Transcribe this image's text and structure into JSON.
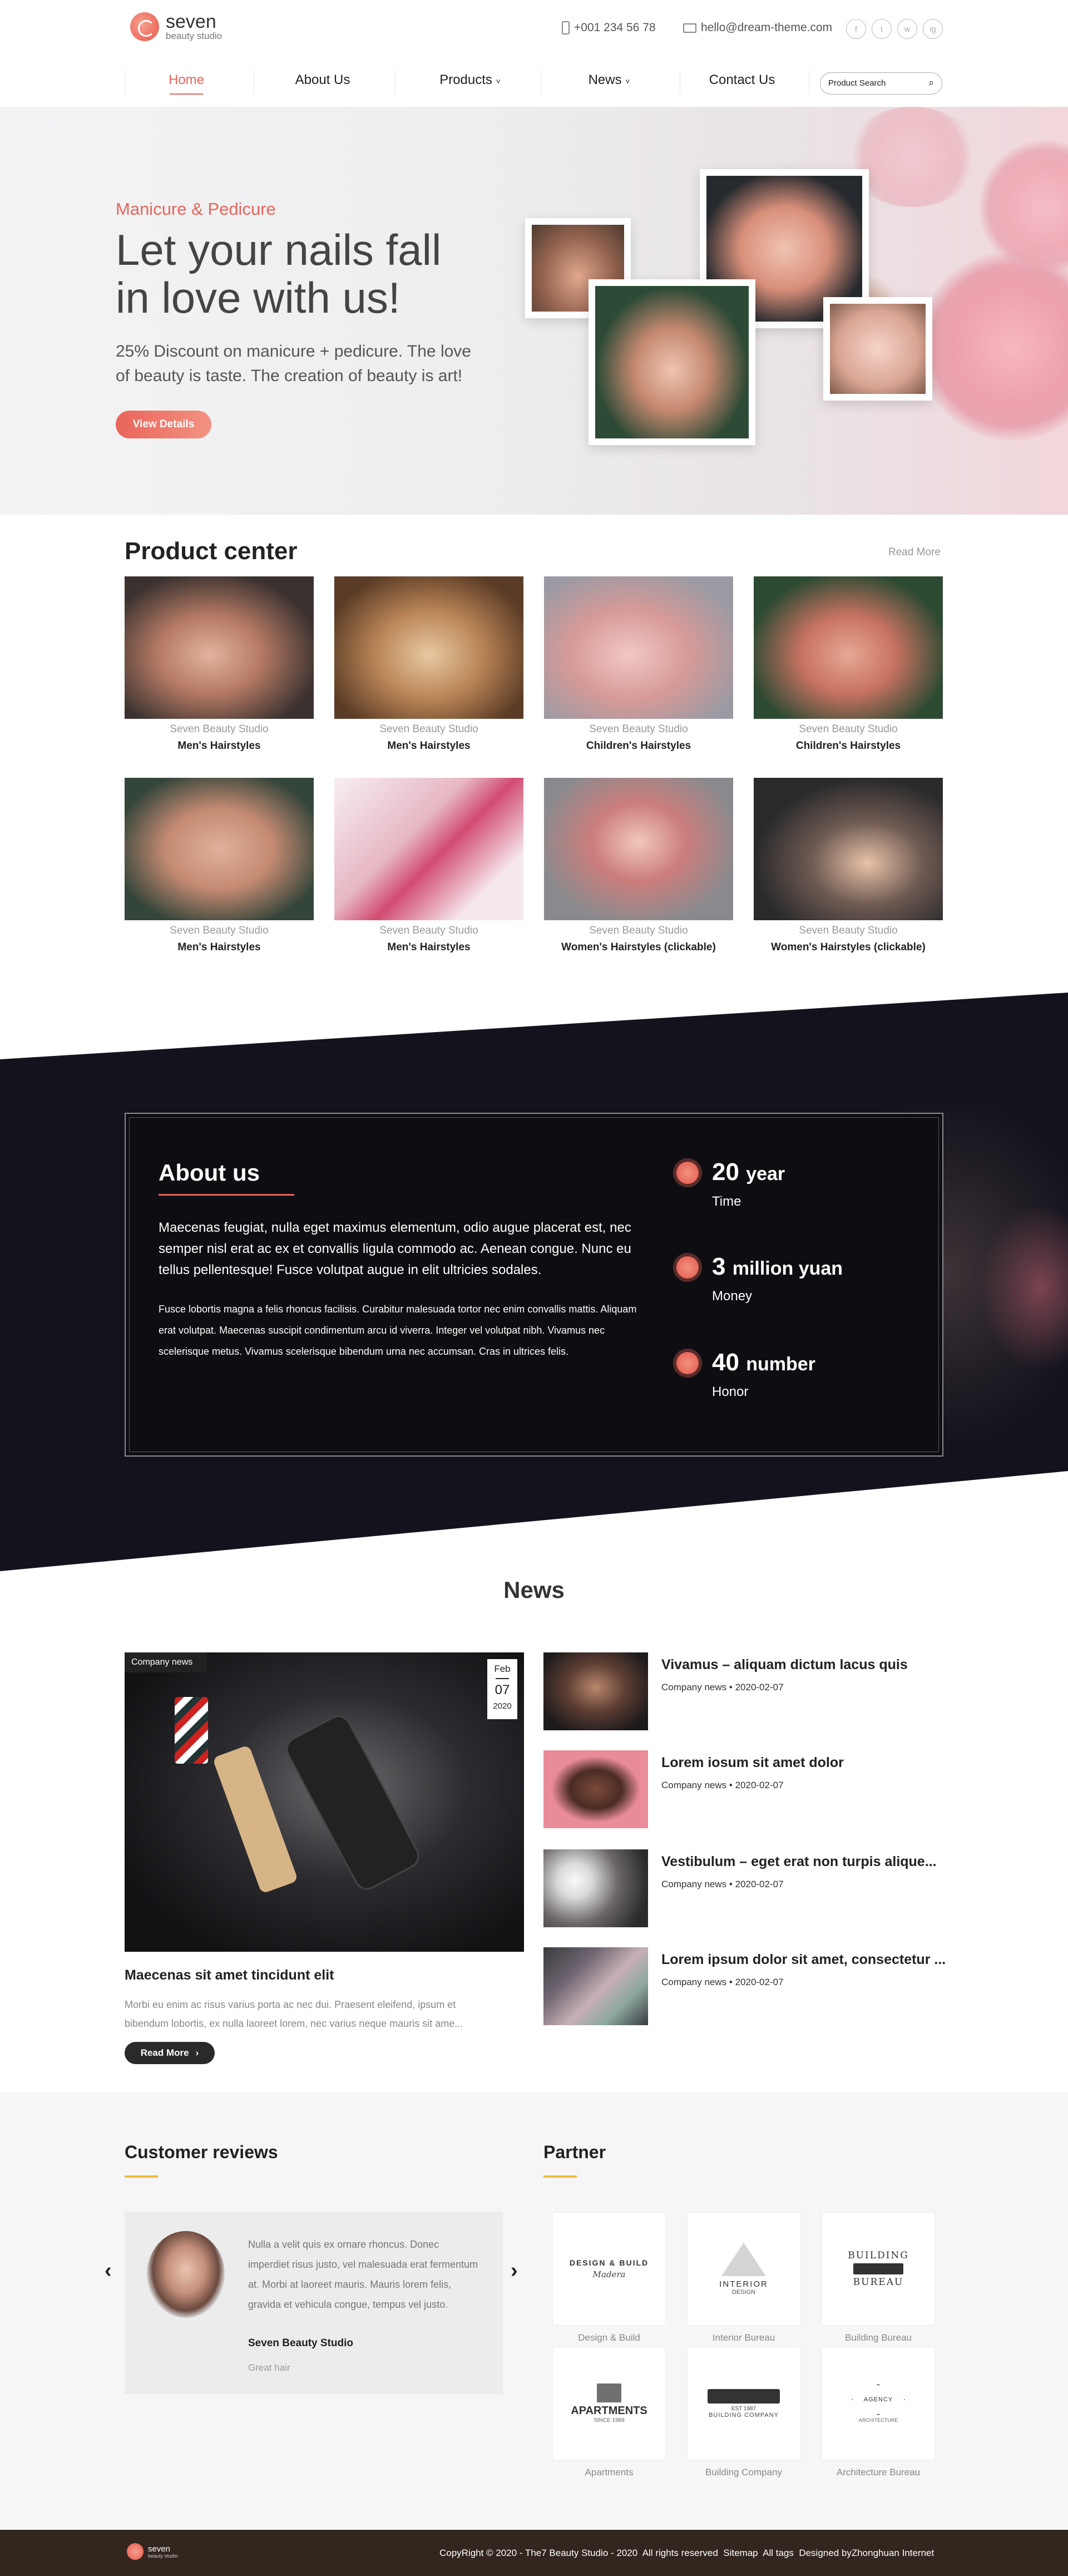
{
  "header": {
    "logo_name": "seven",
    "logo_sub": "beauty studio",
    "phone": "+001 234 56 78",
    "email": "hello@dream-theme.com",
    "social": [
      "f",
      "t",
      "w",
      "ig"
    ],
    "nav": [
      {
        "label": "Home",
        "active": true
      },
      {
        "label": "About Us"
      },
      {
        "label": "Products",
        "dropdown": true
      },
      {
        "label": "News",
        "dropdown": true
      },
      {
        "label": "Contact Us"
      }
    ],
    "search_placeholder": "Product Search"
  },
  "hero": {
    "kicker": "Manicure & Pedicure",
    "title_line1": "Let your nails fall",
    "title_line2": "in love with us!",
    "desc_line1": "25% Discount on manicure + pedicure. The love",
    "desc_line2": "of beauty is taste. The creation of beauty is art!",
    "button": "View Details"
  },
  "products": {
    "title": "Product center",
    "more": "Read More",
    "items": [
      {
        "studio": "Seven Beauty Studio",
        "name": "Men's Hairstyles"
      },
      {
        "studio": "Seven Beauty Studio",
        "name": "Men's Hairstyles"
      },
      {
        "studio": "Seven Beauty Studio",
        "name": "Children's Hairstyles"
      },
      {
        "studio": "Seven Beauty Studio",
        "name": "Children's Hairstyles"
      },
      {
        "studio": "Seven Beauty Studio",
        "name": "Men's Hairstyles"
      },
      {
        "studio": "Seven Beauty Studio",
        "name": "Men's Hairstyles"
      },
      {
        "studio": "Seven Beauty Studio",
        "name": "Women's Hairstyles (clickable)"
      },
      {
        "studio": "Seven Beauty Studio",
        "name": "Women's Hairstyles (clickable)"
      }
    ]
  },
  "about": {
    "title": "About us",
    "lead": "Maecenas feugiat, nulla eget maximus elementum, odio augue placerat est, nec semper nisl erat ac ex et convallis ligula commodo ac. Aenean congue. Nunc eu tellus pellentesque! Fusce volutpat augue in elit ultricies sodales.",
    "body": "Fusce lobortis magna a felis rhoncus facilisis. Curabitur malesuada tortor nec enim convallis mattis. Aliquam erat volutpat. Maecenas suscipit condimentum arcu id viverra. Integer vel volutpat nibh. Vivamus nec scelerisque metus. Vivamus scelerisque bibendum urna nec accumsan. Cras in ultrices felis.",
    "stats": [
      {
        "num": "20",
        "unit": "year",
        "label": "Time"
      },
      {
        "num": "3",
        "unit": "million yuan",
        "label": "Money"
      },
      {
        "num": "40",
        "unit": "number",
        "label": "Honor"
      }
    ]
  },
  "news": {
    "title": "News",
    "featured": {
      "tag": "Company news",
      "month": "Feb",
      "day": "07",
      "year": "2020",
      "title": "Maecenas sit amet tincidunt elit",
      "excerpt_line1": "Morbi eu enim ac risus varius porta ac nec dui. Praesent eleifend, ipsum et",
      "excerpt_line2": "bibendum lobortis, ex nulla laoreet lorem, nec varius neque mauris sit ame...",
      "button": "Read More"
    },
    "items": [
      {
        "title": "Vivamus – aliquam dictum lacus quis",
        "category": "Company news",
        "date": "2020-02-07"
      },
      {
        "title": "Lorem iosum sit amet dolor",
        "category": "Company news",
        "date": "2020-02-07"
      },
      {
        "title": "Vestibulum – eget erat non turpis alique...",
        "category": "Company news",
        "date": "2020-02-07"
      },
      {
        "title": "Lorem ipsum dolor sit amet, consectetur ...",
        "category": "Company news",
        "date": "2020-02-07"
      }
    ]
  },
  "reviews": {
    "title": "Customer reviews",
    "text": "Nulla a velit quis ex ornare rhoncus. Donec imperdiet risus justo, vel malesuada erat fermentum at. Morbi at laoreet mauris. Mauris lorem felis, gravida et vehicula congue, tempus vel justo.",
    "author": "Seven Beauty Studio",
    "role": "Great hair"
  },
  "partners": {
    "title": "Partner",
    "items": [
      {
        "name": "Design & Build",
        "logo_top": "DESIGN & BUILD",
        "logo_mid": "Madera"
      },
      {
        "name": "Interior Bureau",
        "logo_top": "INTERIOR",
        "logo_mid": "DESIGN"
      },
      {
        "name": "Building Bureau",
        "logo_top": "BUILDING",
        "logo_mid": "BUREAU"
      },
      {
        "name": "Apartments",
        "logo_top": "APARTMENTS",
        "logo_mid": "SINCE 1989"
      },
      {
        "name": "Building Company",
        "logo_top": "BUILDING COMPANY",
        "logo_mid": "EST 1987"
      },
      {
        "name": "Architecture Bureau",
        "logo_top": "AGENCY",
        "logo_mid": "ARCHITECTURE"
      }
    ]
  },
  "footer": {
    "copyright": "CopyRight © 2020 - The7 Beauty Studio - 2020  All rights reserved",
    "sitemap": "Sitemap",
    "tags": "All tags",
    "designed": "Designed byZhonghuan Internet"
  },
  "colors": {
    "accent": "#e8655b",
    "dark": "#13131d",
    "footer": "#32261f"
  }
}
